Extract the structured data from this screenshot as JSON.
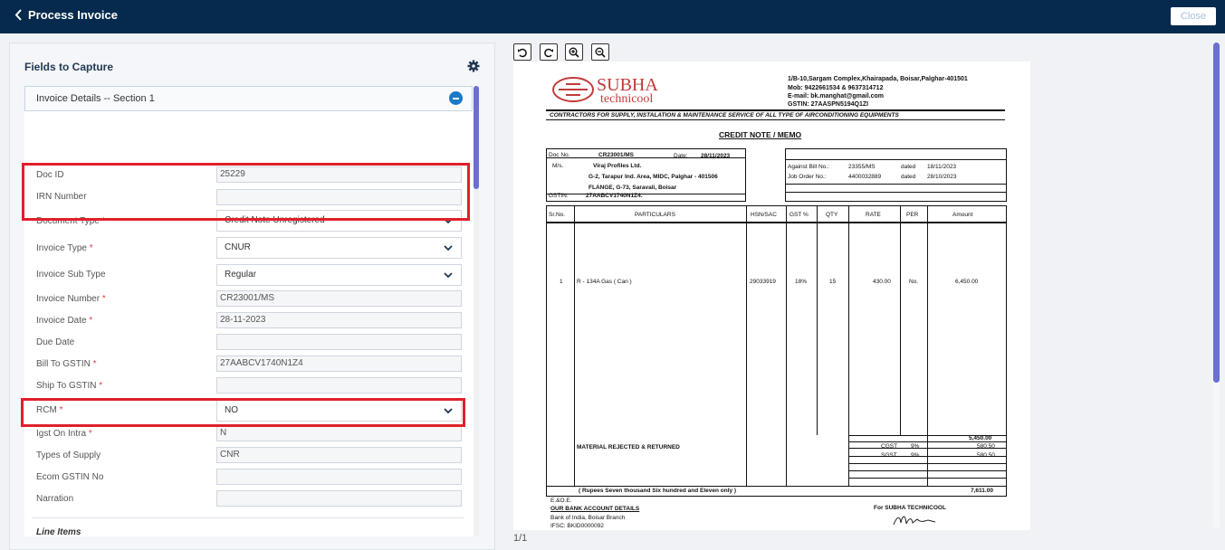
{
  "header": {
    "title": "Process Invoice",
    "close_label": "Close"
  },
  "panel": {
    "title": "Fields to Capture",
    "section_title": "Invoice Details -- Section 1",
    "line_items_label": "Line Items"
  },
  "fields": {
    "doc_id": {
      "label": "Doc ID",
      "value": "25229"
    },
    "irn_number": {
      "label": "IRN Number",
      "value": ""
    },
    "document_type": {
      "label": "Document Type",
      "value": "Credit Note Unregistered"
    },
    "invoice_type": {
      "label": "Invoice Type",
      "value": "CNUR"
    },
    "invoice_sub_type": {
      "label": "Invoice Sub Type",
      "value": "Regular"
    },
    "invoice_number": {
      "label": "Invoice Number",
      "value": "CR23001/MS"
    },
    "invoice_date": {
      "label": "Invoice Date",
      "value": "28-11-2023"
    },
    "due_date": {
      "label": "Due Date",
      "value": ""
    },
    "bill_to_gstin": {
      "label": "Bill To GSTIN",
      "value": "27AABCV1740N1Z4"
    },
    "ship_to_gstin": {
      "label": "Ship To GSTIN",
      "value": ""
    },
    "rcm": {
      "label": "RCM",
      "value": "NO"
    },
    "igst_on_intra": {
      "label": "Igst On Intra",
      "value": "N"
    },
    "types_of_supply": {
      "label": "Types of Supply",
      "value": "CNR"
    },
    "ecom_gstin_no": {
      "label": "Ecom GSTIN No",
      "value": ""
    },
    "narration": {
      "label": "Narration",
      "value": ""
    }
  },
  "required_mark": "*",
  "viewer": {
    "page_indicator": "1/1",
    "tools": [
      "rotate-left-icon",
      "rotate-right-icon",
      "zoom-in-icon",
      "zoom-out-icon"
    ]
  },
  "document": {
    "logo_name": "SUBHA",
    "logo_sub": "technicool",
    "address": "1/B-10,Sargam Complex,Khairapada, Boisar,Palghar-401501",
    "mob": "Mob:   9422661534 & 9637314712",
    "email": "E-mail:  bk.manghat@gmail.com",
    "gstin": "GSTIN:   27AASPN5194Q1ZI",
    "tagline": "CONTRACTORS FOR SUPPLY, INSTALATION & MAINTENANCE SERVICE OF ALL TYPE OF  AIRCONDITIONING EQUIPMENTS",
    "heading": "CREDIT NOTE / MEMO",
    "doc_no_label": "Doc No.",
    "doc_no": "CR23001/MS",
    "date_label": "Date:",
    "date": "28/11/2023",
    "ms_label": "M/s.",
    "buyer_name": "Viraj Profiles Ltd.",
    "buyer_addr1": "G-2, Tarapur Ind. Area, MIDC, Palghar - 401506",
    "buyer_addr2": "FLANGE, G-73, Saravali, Boisar",
    "buyer_gstin_label": "GSTIN:",
    "buyer_gstin": "27AABCV1740N1Z4.",
    "against_bill_label": "Against Bill No.:",
    "against_bill_no": "23355/MS",
    "dated_label": "dated",
    "against_bill_date": "18/11/2023",
    "job_order_label": "Job Order No.:",
    "job_order_no": "4400032889",
    "job_order_date": "28/10/2023",
    "columns": [
      "Sr.No.",
      "PARTICULARS",
      "HSN/SAC",
      "GST %",
      "QTY",
      "RATE",
      "PER",
      "Amount"
    ],
    "item": {
      "sr": "1",
      "particulars": "R - 134A Gas ( Can )",
      "hsn": "29033919",
      "gst": "18%",
      "qty": "15",
      "rate": "430.00",
      "per": "No.",
      "amount": "6,450.00"
    },
    "remark": "MATERIAL REJECTED & RETURNED",
    "subtotal": "5,450.00",
    "cgst_label": "CGST",
    "cgst_rate": "9%",
    "cgst_amount": "580.50",
    "sgst_label": "SGST",
    "sgst_rate": "9%",
    "sgst_amount": "580.50",
    "amount_words": "( Rupees Seven thousand Six hundred and Eleven only )",
    "total": "7,611.00",
    "eoe": "E.&O.E.",
    "bank_heading": "OUR BANK ACCOUNT DETAILS",
    "bank_name": "Bank of India, Boisar Branch",
    "ifsc": "IFSC: BKID0000092",
    "for_label": "For SUBHA TECHNICOOL"
  }
}
